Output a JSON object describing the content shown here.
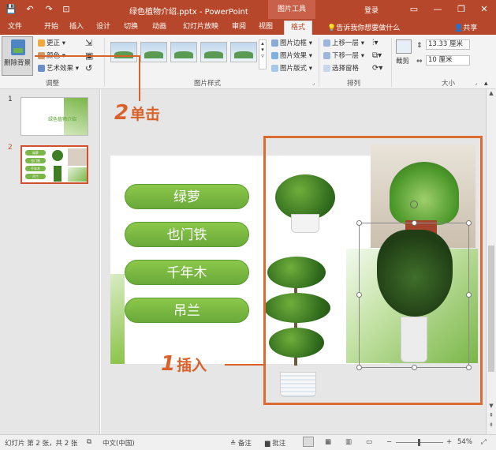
{
  "window": {
    "title": "绿色植物介绍.pptx - PowerPoint",
    "context_title": "图片工具",
    "login": "登录",
    "controls": [
      "—",
      "❐",
      "✕"
    ]
  },
  "quick_access": [
    "💾",
    "↶",
    "↷",
    "⊡"
  ],
  "tabs": [
    "文件",
    "开始",
    "插入",
    "设计",
    "切换",
    "动画",
    "幻灯片放映",
    "审阅",
    "视图",
    "格式"
  ],
  "active_tab": "格式",
  "tell_me": "告诉我你想要做什么",
  "share": "共享",
  "ribbon": {
    "adjust": {
      "remove_bg": "删除背景",
      "corrections": "更正",
      "color": "颜色",
      "artistic": "艺术效果",
      "group_label": "调整"
    },
    "styles": {
      "border": "图片边框",
      "effects": "图片效果",
      "layout": "图片版式",
      "group_label": "图片样式"
    },
    "arrange": {
      "bring_forward": "上移一层",
      "send_backward": "下移一层",
      "selection_pane": "选择窗格",
      "group_label": "排列"
    },
    "size": {
      "crop": "裁剪",
      "height": "13.33 厘米",
      "width": "10 厘米",
      "group_label": "大小"
    }
  },
  "slides": {
    "numbers": [
      "1",
      "2"
    ],
    "thumb1_title": "绿色植物介绍",
    "thumb2_items": [
      "绿萝",
      "也门铁",
      "千年木",
      "吊兰"
    ]
  },
  "slide_content": {
    "pills": [
      "绿萝",
      "也门铁",
      "千年木",
      "吊兰"
    ]
  },
  "callouts": {
    "click_num": "2",
    "click_text": "单击",
    "insert_num": "1",
    "insert_text": "插入"
  },
  "statusbar": {
    "slide_info": "幻灯片 第 2 张，共 2 张",
    "language": "中文(中国)",
    "notes": "备注",
    "comments": "批注",
    "zoom": "54%"
  },
  "colors": {
    "brand": "#b7472a",
    "accent": "#d9622b",
    "pill_green": "#7ab648"
  }
}
